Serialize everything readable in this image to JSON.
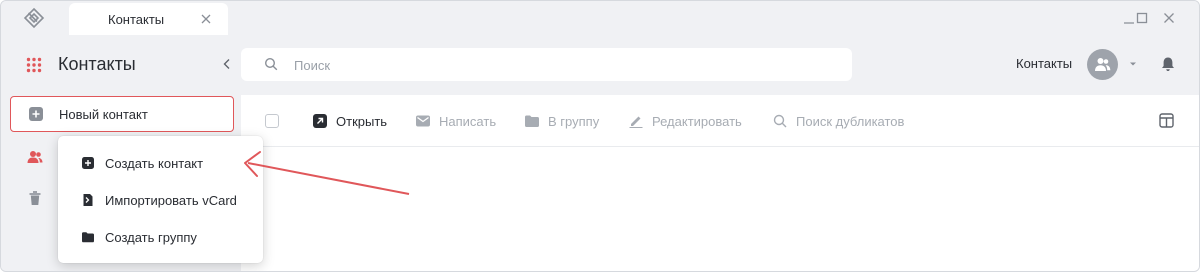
{
  "titlebar": {
    "tab_label": "Контакты",
    "icons": [
      "app-logo-icon",
      "close-icon",
      "minimize-icon",
      "maximize-icon",
      "window-close-icon"
    ]
  },
  "sidebar": {
    "title": "Контакты",
    "new_contact_label": "Новый контакт",
    "items": [
      {
        "icon": "contacts-icon",
        "active": true
      },
      {
        "icon": "trash-icon",
        "active": false
      }
    ]
  },
  "header": {
    "search_placeholder": "Поиск",
    "search_value": "",
    "section_label": "Контакты"
  },
  "toolbar": {
    "open": "Открыть",
    "write": "Написать",
    "to_group": "В группу",
    "edit": "Редактировать",
    "find_duplicates": "Поиск дубликатов"
  },
  "dropdown": {
    "items": [
      {
        "label": "Создать контакт",
        "icon": "add-contact-icon"
      },
      {
        "label": "Импортировать vCard",
        "icon": "import-file-icon"
      },
      {
        "label": "Создать группу",
        "icon": "folder-icon"
      }
    ]
  },
  "colors": {
    "accent_red": "#e0575a",
    "sidebar_bg": "#f0f1f4",
    "text": "#2a2d33",
    "disabled_text": "#a7acb3"
  }
}
